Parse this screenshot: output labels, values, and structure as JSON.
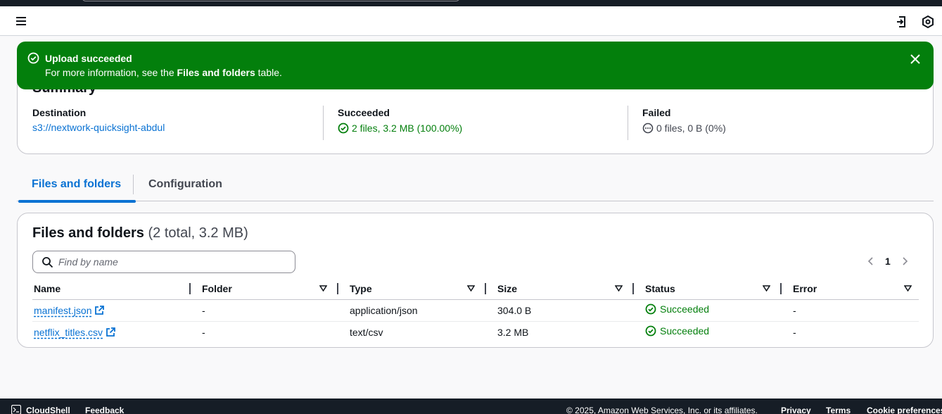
{
  "header": {
    "menu_icon": "hamburger-icon",
    "right_icons": [
      "export-icon",
      "hex-settings-icon"
    ]
  },
  "flash": {
    "title": "Upload succeeded",
    "message_prefix": "For more information, see the ",
    "message_bold": "Files and folders",
    "message_suffix": " table.",
    "color": "#037f0c"
  },
  "summary": {
    "title": "Summary",
    "destination_label": "Destination",
    "destination_value": "s3://nextwork-quicksight-abdul",
    "succeeded_label": "Succeeded",
    "succeeded_value": "2 files, 3.2 MB (100.00%)",
    "failed_label": "Failed",
    "failed_value": "0 files, 0 B (0%)"
  },
  "tabs": [
    {
      "label": "Files and folders",
      "active": true
    },
    {
      "label": "Configuration",
      "active": false
    }
  ],
  "files": {
    "title": "Files and folders",
    "count": "(2 total, 3.2 MB)",
    "search_placeholder": "Find by name",
    "page": "1",
    "columns": [
      "Name",
      "Folder",
      "Type",
      "Size",
      "Status",
      "Error"
    ],
    "rows": [
      {
        "name": "manifest.json",
        "folder": "-",
        "type": "application/json",
        "size": "304.0 B",
        "status": "Succeeded",
        "error": "-"
      },
      {
        "name": "netflix_titles.csv",
        "folder": "-",
        "type": "text/csv",
        "size": "3.2 MB",
        "status": "Succeeded",
        "error": "-"
      }
    ]
  },
  "footer": {
    "cloudshell": "CloudShell",
    "feedback": "Feedback",
    "copyright": "© 2025, Amazon Web Services, Inc. or its affiliates.",
    "privacy": "Privacy",
    "terms": "Terms",
    "cookies": "Cookie preferences"
  }
}
